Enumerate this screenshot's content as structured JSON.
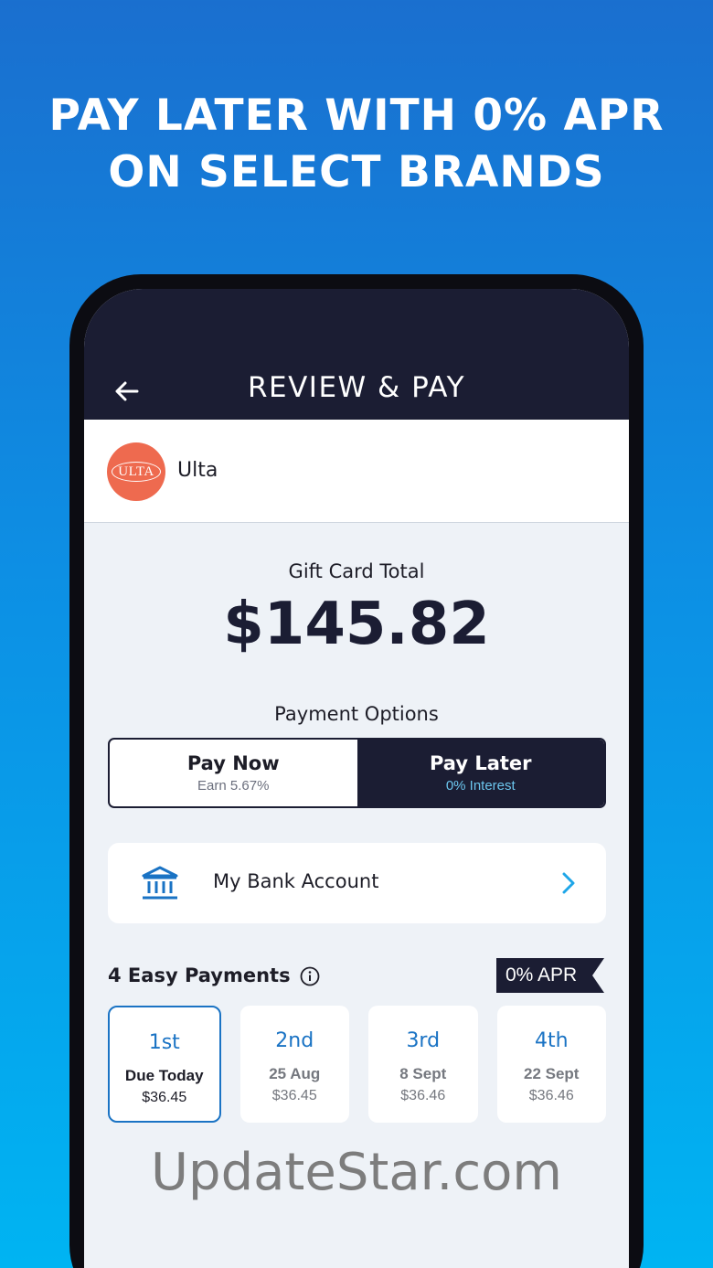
{
  "headline": {
    "line1": "PAY LATER WITH 0% APR",
    "line2": "ON SELECT BRANDS"
  },
  "appbar": {
    "title": "REVIEW & PAY",
    "back_icon": "arrow-left-icon"
  },
  "merchant": {
    "logo_text": "ULTA",
    "name": "Ulta",
    "brand_color": "#ee6a4f"
  },
  "total": {
    "label": "Gift Card Total",
    "amount": "$145.82"
  },
  "payment_options": {
    "label": "Payment Options",
    "options": [
      {
        "title": "Pay Now",
        "subtitle": "Earn 5.67%",
        "selected": false
      },
      {
        "title": "Pay Later",
        "subtitle": "0% Interest",
        "selected": true
      }
    ]
  },
  "bank": {
    "icon": "bank-icon",
    "label": "My Bank Account",
    "chevron_icon": "chevron-right-icon"
  },
  "payments": {
    "label": "4 Easy Payments",
    "badge": "0% APR",
    "items": [
      {
        "ordinal": "1st",
        "date": "Due Today",
        "amount": "$36.45",
        "selected": true
      },
      {
        "ordinal": "2nd",
        "date": "25 Aug",
        "amount": "$36.45",
        "selected": false
      },
      {
        "ordinal": "3rd",
        "date": "8 Sept",
        "amount": "$36.46",
        "selected": false
      },
      {
        "ordinal": "4th",
        "date": "22 Sept",
        "amount": "$36.46",
        "selected": false
      }
    ]
  },
  "colors": {
    "dark_navy": "#1b1d33",
    "accent_blue": "#1a73c4",
    "light_blue": "#6cc6ee"
  },
  "watermark": "UpdateStar.com"
}
